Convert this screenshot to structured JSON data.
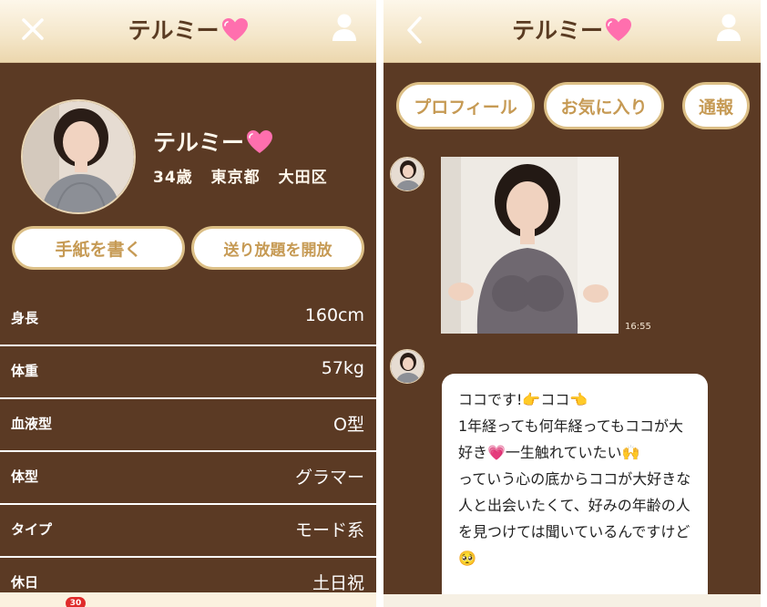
{
  "profile_screen": {
    "title": "テルミー",
    "name": "テルミー",
    "age": "34歳",
    "prefecture": "東京都",
    "city": "大田区",
    "buttons": {
      "write_letter": "手紙を書く",
      "unlimited": "送り放題を開放"
    },
    "details": [
      {
        "label": "身長",
        "value": "160cm"
      },
      {
        "label": "体重",
        "value": "57kg"
      },
      {
        "label": "血液型",
        "value": "O型"
      },
      {
        "label": "体型",
        "value": "グラマー"
      },
      {
        "label": "タイプ",
        "value": "モード系"
      },
      {
        "label": "休日",
        "value": "土日祝"
      }
    ],
    "tab_badge": "30"
  },
  "chat_screen": {
    "title": "テルミー",
    "tabs": {
      "profile": "プロフィール",
      "favorite": "お気に入り",
      "report": "通報"
    },
    "photo_time": "16:55",
    "message": "ココです!👉ココ👈\n1年経っても何年経ってもココが大好き💗一生触れていたい🙌\nっていう心の底からココが大好きな人と出会いたくて、好みの年齢の人を見つけては聞いているんですけど🥺"
  },
  "colors": {
    "background": "#5b3a24",
    "header": "#f4e6c9",
    "accent": "#c69a54",
    "heart": "#ff6fae",
    "badge": "#e02b2b"
  },
  "icons": [
    "close-icon",
    "user-icon",
    "back-icon",
    "heart-icon"
  ]
}
